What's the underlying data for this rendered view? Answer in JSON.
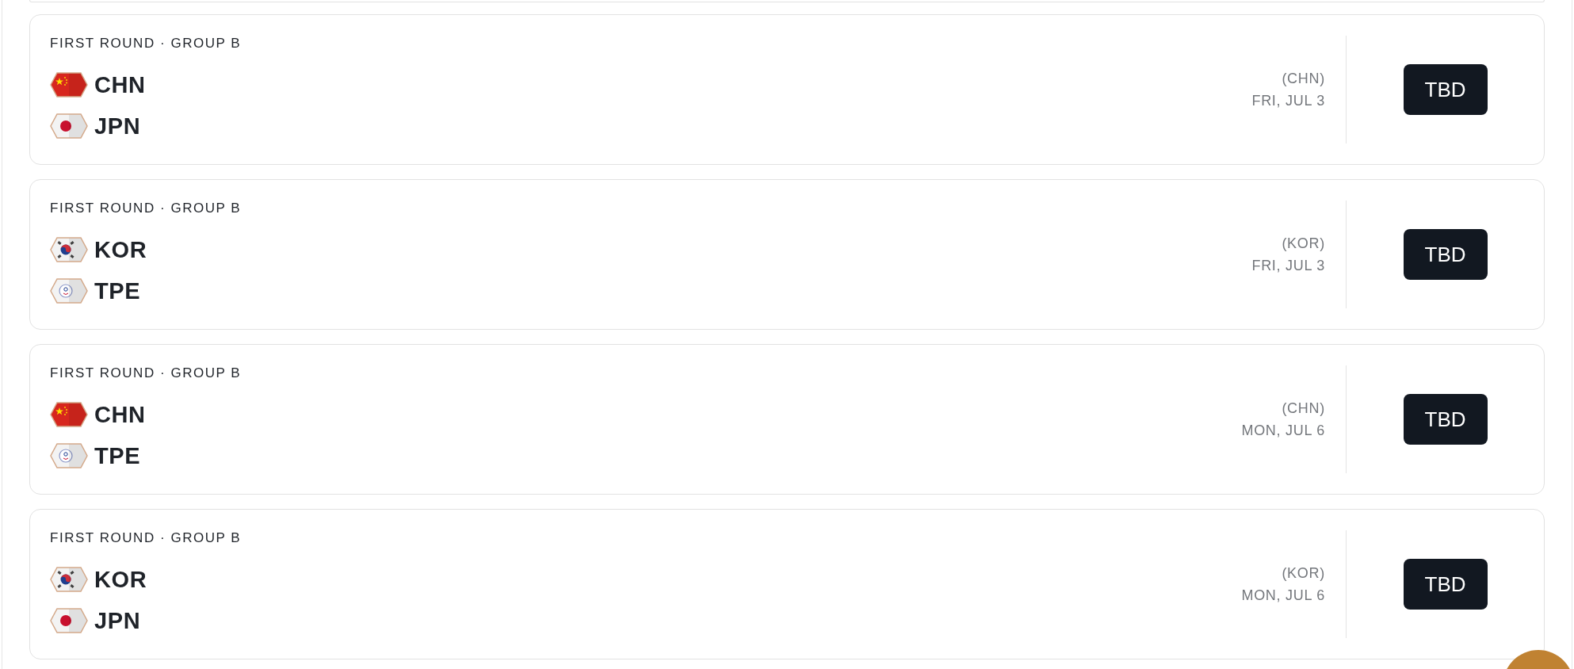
{
  "matches": [
    {
      "stage": "FIRST ROUND · GROUP B",
      "teams": [
        {
          "code": "CHN",
          "kind": "china"
        },
        {
          "code": "JPN",
          "kind": "japan"
        }
      ],
      "host": "(CHN)",
      "date": "FRI, JUL 3",
      "action": "TBD"
    },
    {
      "stage": "FIRST ROUND · GROUP B",
      "teams": [
        {
          "code": "KOR",
          "kind": "korea"
        },
        {
          "code": "TPE",
          "kind": "taipei"
        }
      ],
      "host": "(KOR)",
      "date": "FRI, JUL 3",
      "action": "TBD"
    },
    {
      "stage": "FIRST ROUND · GROUP B",
      "teams": [
        {
          "code": "CHN",
          "kind": "china"
        },
        {
          "code": "TPE",
          "kind": "taipei"
        }
      ],
      "host": "(CHN)",
      "date": "MON, JUL 6",
      "action": "TBD"
    },
    {
      "stage": "FIRST ROUND · GROUP B",
      "teams": [
        {
          "code": "KOR",
          "kind": "korea"
        },
        {
          "code": "JPN",
          "kind": "japan"
        }
      ],
      "host": "(KOR)",
      "date": "MON, JUL 6",
      "action": "TBD"
    }
  ]
}
